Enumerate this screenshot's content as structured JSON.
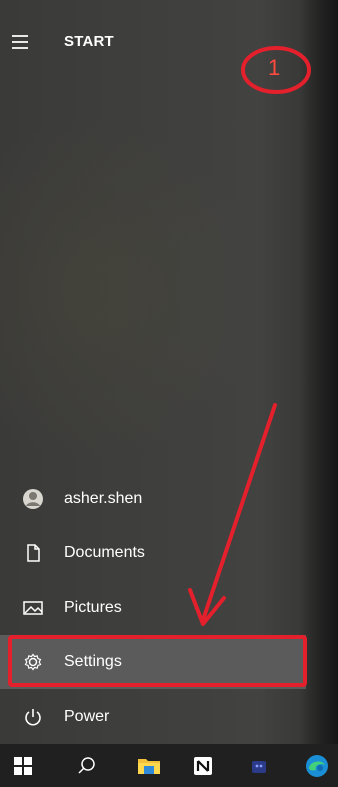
{
  "start_menu": {
    "title": "START",
    "annotation_step": "1",
    "items": [
      {
        "label": "asher.shen",
        "icon": "user-avatar-icon"
      },
      {
        "label": "Documents",
        "icon": "document-icon"
      },
      {
        "label": "Pictures",
        "icon": "picture-icon"
      },
      {
        "label": "Settings",
        "icon": "gear-icon"
      },
      {
        "label": "Power",
        "icon": "power-icon"
      }
    ]
  },
  "taskbar": {
    "items": [
      {
        "name": "windows-start",
        "icon": "windows-logo-icon"
      },
      {
        "name": "search",
        "icon": "search-icon"
      },
      {
        "name": "file-explorer",
        "icon": "folder-icon"
      },
      {
        "name": "notion",
        "icon": "notion-icon"
      },
      {
        "name": "app",
        "icon": "app-icon"
      },
      {
        "name": "edge",
        "icon": "edge-icon"
      }
    ]
  },
  "colors": {
    "annotation_red": "#e3202b",
    "highlight_bg": "#5b5b5b",
    "taskbar_bg": "#202020"
  }
}
